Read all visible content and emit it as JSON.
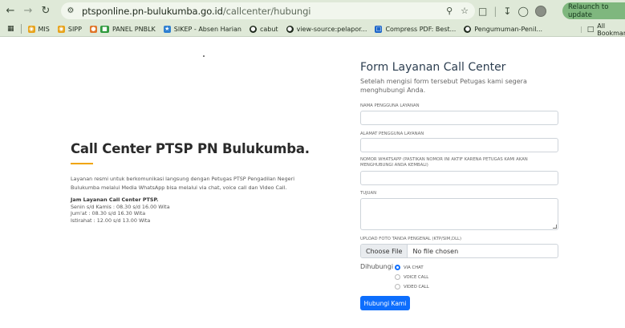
{
  "browser": {
    "url_host": "ptsponline.pn-bulukumba.go.id",
    "url_path": "/callcenter/hubungi",
    "relaunch_label": "Relaunch to update",
    "bookmarks": [
      "MIS",
      "SIPP",
      "PANEL PNBLK",
      "SIKEP - Absen Harian",
      "cabut",
      "view-source:pelapor...",
      "Compress PDF: Best...",
      "Pengumuman-Penil..."
    ],
    "all_bookmarks": "All Bookmarks"
  },
  "left": {
    "title": "Call Center PTSP PN Bulukumba.",
    "description": "Layanan resmi untuk berkomunikasi langsung dengan Petugas PTSP Pengadilan Negeri Bulukumba melalui Media WhatsApp bisa melalui via chat, voice call dan Video Call.",
    "hours_title": "Jam Layanan Call Center PTSP.",
    "hours": [
      "Senin s/d Kamis : 08.30 s/d 16.00 Wita",
      "Jum'at : 08.30 s/d 16.30 Wita",
      "Istirahat : 12.00 s/d 13.00 Wita"
    ]
  },
  "form": {
    "title": "Form Layanan Call Center",
    "subtitle": "Setelah mengisi form tersebut Petugas kami segera menghubungi Anda.",
    "label_name": "NAMA PENGGUNA LAYANAN",
    "label_address": "ALAMAT PENGGUNA LAYANAN",
    "label_whatsapp": "NOMOR WHATSAPP (PASTIKAN NOMOR INI AKTIF KARENA PETUGAS KAMI AKAN MENGHUBUNGI ANDA KEMBALI)",
    "label_purpose": "TUJUAN",
    "label_upload": "UPLOAD FOTO TANDA PENGENAL (KTP/SIM,DLL)",
    "file_button": "Choose File",
    "file_status": "No file chosen",
    "contact_label": "Dihubungi",
    "options": [
      "VIA CHAT",
      "VOICE CALL",
      "VIDEO CALL"
    ],
    "selected_option": "VIA CHAT",
    "submit_label": "Hubungi Kami"
  }
}
